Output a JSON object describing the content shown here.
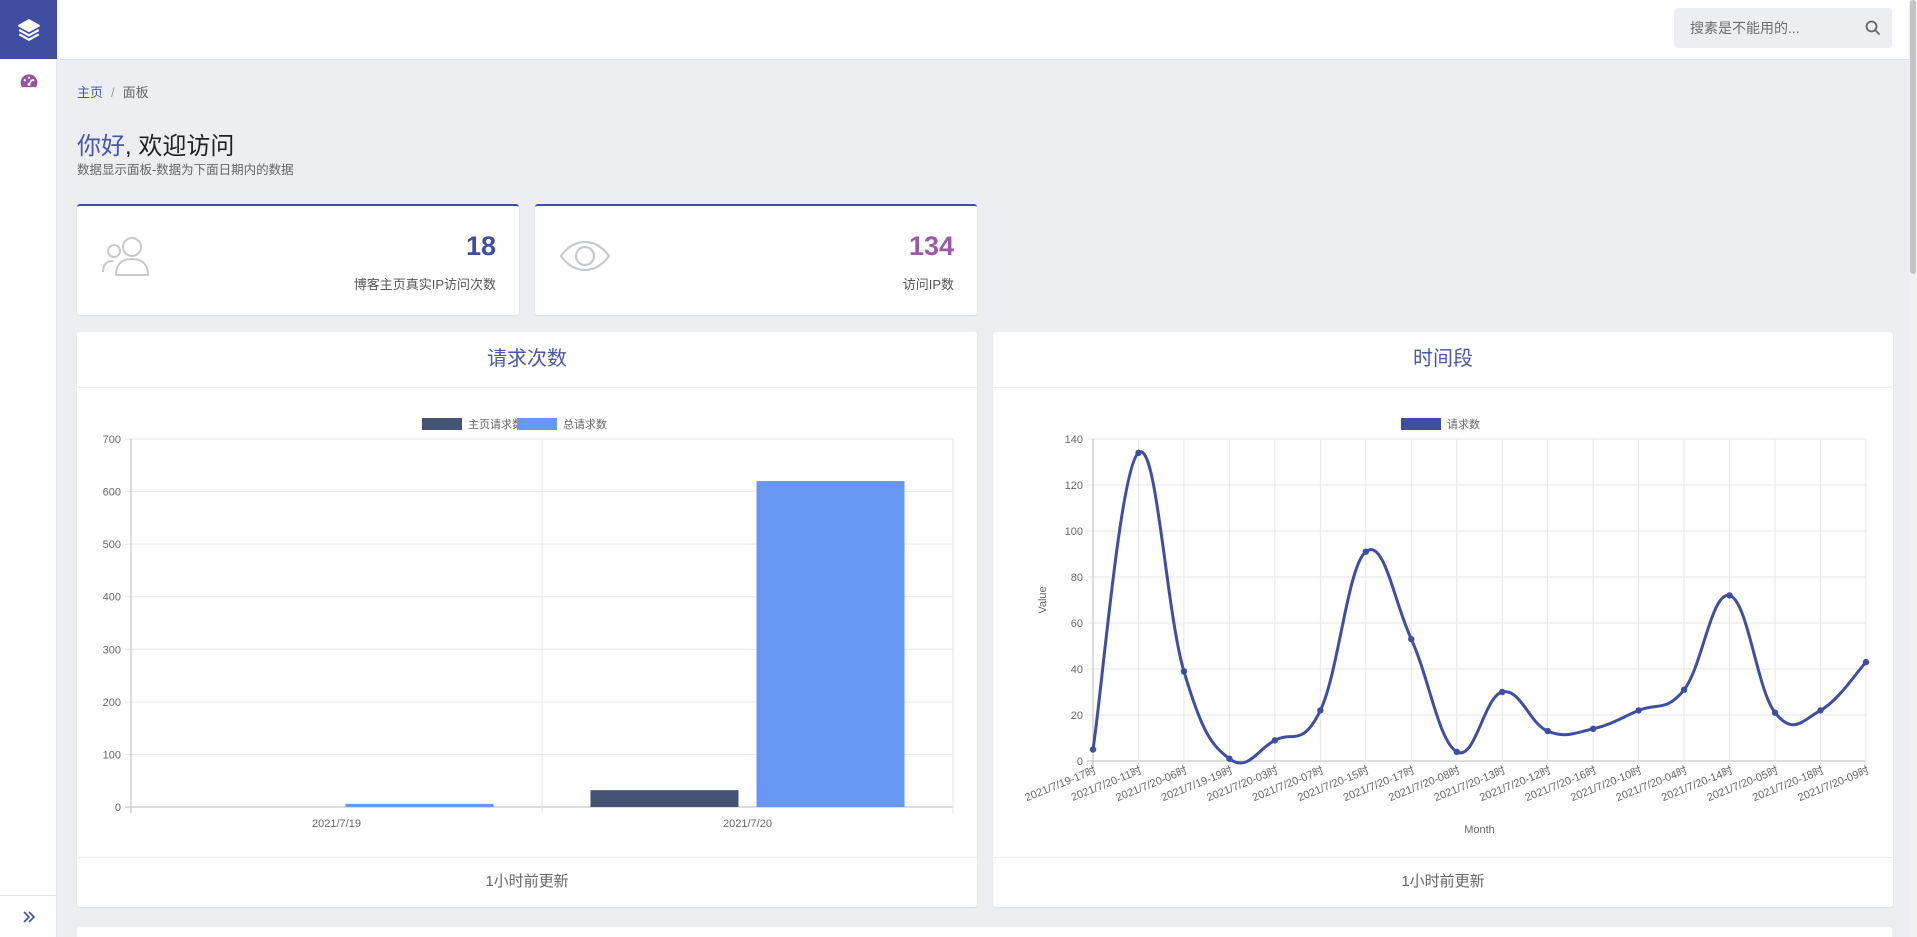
{
  "header": {
    "search_placeholder": "搜素是不能用的..."
  },
  "sidebar": {
    "icons": [
      "layers-icon",
      "dashboard-icon",
      "double-chevron-right-icon"
    ]
  },
  "breadcrumb": {
    "home": "主页",
    "separator": "/",
    "current": "面板"
  },
  "welcome": {
    "hi": "你好",
    "rest": ", 欢迎访问",
    "subtitle": "数据显示面板-数据为下面日期内的数据"
  },
  "stats": [
    {
      "value": "18",
      "label": "博客主页真实IP访问次数",
      "icon": "users-icon",
      "color": "#3f4ea1"
    },
    {
      "value": "134",
      "label": "访问IP数",
      "icon": "eye-icon",
      "color": "#9b59a8"
    }
  ],
  "panels": [
    {
      "title": "请求次数",
      "footer": "1小时前更新"
    },
    {
      "title": "时间段",
      "footer": "1小时前更新"
    }
  ],
  "colors": {
    "primary": "#3f4ea1",
    "accent": "#9b59a8",
    "bar_dark": "#445374",
    "bar_light": "#6698f3",
    "line": "#3f4ea1"
  },
  "chart_data": [
    {
      "type": "bar",
      "categories": [
        "2021/7/19",
        "2021/7/20"
      ],
      "series": [
        {
          "name": "主页请求数",
          "values": [
            0,
            32
          ]
        },
        {
          "name": "总请求数",
          "values": [
            6,
            620
          ]
        }
      ],
      "ylim": [
        0,
        700
      ],
      "yticks": [
        0,
        100,
        200,
        300,
        400,
        500,
        600,
        700
      ],
      "legend": "top",
      "grid": true
    },
    {
      "type": "line",
      "x": [
        "2021/7/19-17时",
        "2021/7/20-11时",
        "2021/7/20-06时",
        "2021/7/19-19时",
        "2021/7/20-03时",
        "2021/7/20-07时",
        "2021/7/20-15时",
        "2021/7/20-17时",
        "2021/7/20-08时",
        "2021/7/20-13时",
        "2021/7/20-12时",
        "2021/7/20-16时",
        "2021/7/20-10时",
        "2021/7/20-04时",
        "2021/7/20-14时",
        "2021/7/20-05时",
        "2021/7/20-18时",
        "2021/7/20-09时"
      ],
      "series": [
        {
          "name": "请求数",
          "values": [
            5,
            134,
            39,
            1,
            9,
            22,
            91,
            53,
            4,
            30,
            13,
            14,
            22,
            31,
            72,
            21,
            22,
            43
          ]
        }
      ],
      "xlabel": "Month",
      "ylabel": "Value",
      "ylim": [
        0,
        140
      ],
      "yticks": [
        0,
        20,
        40,
        60,
        80,
        100,
        120,
        140
      ],
      "legend": "top",
      "grid": true
    }
  ]
}
